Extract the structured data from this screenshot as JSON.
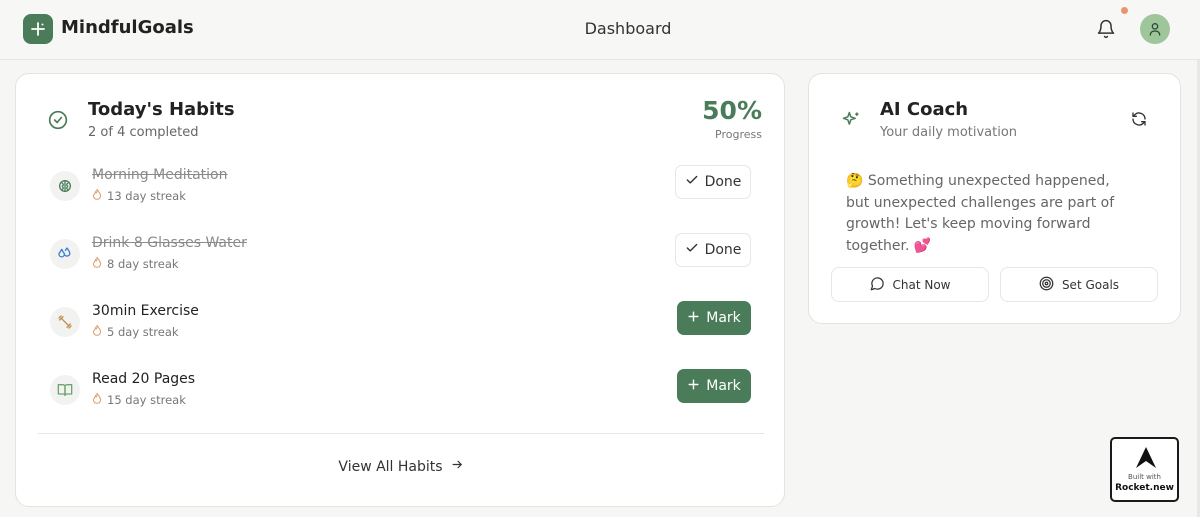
{
  "header": {
    "brand": "MindfulGoals",
    "page_title": "Dashboard"
  },
  "habits_card": {
    "title": "Today's Habits",
    "subtitle": "2 of 4 completed",
    "progress_value": "50%",
    "progress_label": "Progress",
    "items": [
      {
        "name": "Morning Meditation",
        "streak": "13 day streak",
        "completed": true,
        "button": "Done",
        "icon": "brain-icon"
      },
      {
        "name": "Drink 8 Glasses Water",
        "streak": "8 day streak",
        "completed": true,
        "button": "Done",
        "icon": "droplets-icon"
      },
      {
        "name": "30min Exercise",
        "streak": "5 day streak",
        "completed": false,
        "button": "Mark",
        "icon": "dumbbell-icon"
      },
      {
        "name": "Read 20 Pages",
        "streak": "15 day streak",
        "completed": false,
        "button": "Mark",
        "icon": "book-icon"
      }
    ],
    "view_all": "View All Habits"
  },
  "coach_card": {
    "title": "AI Coach",
    "subtitle": "Your daily motivation",
    "message": "🤔 Something unexpected happened, but unexpected challenges are part of growth! Let's keep moving forward together. 💕",
    "chat_button": "Chat Now",
    "goals_button": "Set Goals"
  },
  "badge": {
    "line1": "Built with",
    "line2": "Rocket.new"
  },
  "colors": {
    "accent": "#4a7c59",
    "avatar": "#9fc69a",
    "notification": "#e8956a",
    "streak_flame": "#e0a070"
  }
}
